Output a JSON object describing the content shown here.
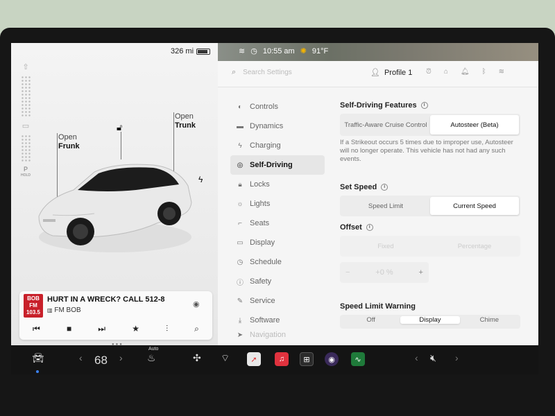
{
  "status_bar": {
    "range": "326 mi",
    "time": "10:55 am",
    "temperature": "91°F"
  },
  "car_panel": {
    "frunk": {
      "line1": "Open",
      "line2": "Frunk"
    },
    "trunk": {
      "line1": "Open",
      "line2": "Trunk"
    },
    "gear": {
      "label": "P",
      "sub": "HOLD"
    }
  },
  "media": {
    "logo_line1": "BOB",
    "logo_line2": "FM",
    "logo_line3": "103.5",
    "title": "HURT IN A WRECK? CALL 512-8",
    "station": "FM BOB"
  },
  "settings_header": {
    "search_placeholder": "Search Settings",
    "profile": "Profile 1"
  },
  "sidebar": {
    "items": [
      {
        "label": "Controls",
        "icon": "toggle-icon"
      },
      {
        "label": "Dynamics",
        "icon": "car-icon"
      },
      {
        "label": "Charging",
        "icon": "bolt-icon"
      },
      {
        "label": "Self-Driving",
        "icon": "steering-wheel-icon"
      },
      {
        "label": "Locks",
        "icon": "lock-icon"
      },
      {
        "label": "Lights",
        "icon": "sun-icon"
      },
      {
        "label": "Seats",
        "icon": "seat-icon"
      },
      {
        "label": "Display",
        "icon": "display-icon"
      },
      {
        "label": "Schedule",
        "icon": "clock-icon"
      },
      {
        "label": "Safety",
        "icon": "safety-icon"
      },
      {
        "label": "Service",
        "icon": "wrench-icon"
      },
      {
        "label": "Software",
        "icon": "download-icon"
      },
      {
        "label": "Navigation",
        "icon": "navigation-icon"
      }
    ],
    "active": "Self-Driving"
  },
  "content": {
    "self_driving": {
      "title": "Self-Driving Features",
      "options": [
        "Traffic-Aware Cruise Control",
        "Autosteer (Beta)"
      ],
      "selected": 1,
      "note": "If a Strikeout occurs 5 times due to improper use, Autosteer will no longer operate. This vehicle has not had any such events."
    },
    "set_speed": {
      "title": "Set Speed",
      "options": [
        "Speed Limit",
        "Current Speed"
      ],
      "selected": 1
    },
    "offset": {
      "title": "Offset",
      "options": [
        "Fixed",
        "Percentage"
      ],
      "stepper_minus": "−",
      "stepper_value": "+0 %",
      "stepper_plus": "+"
    },
    "speed_limit_warning": {
      "title": "Speed Limit Warning",
      "options": [
        "Off",
        "Display",
        "Chime"
      ],
      "selected": 1
    }
  },
  "dock": {
    "temperature": "68",
    "seat_heat_label": "Auto"
  },
  "colors": {
    "accent_blue": "#3b82f6",
    "radio_red": "#c8202a"
  }
}
